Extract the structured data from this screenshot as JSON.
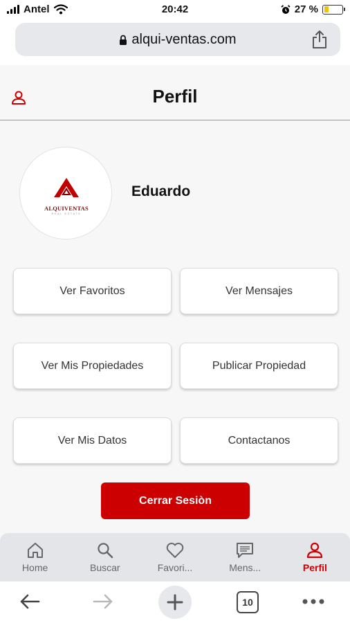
{
  "status_bar": {
    "carrier": "Antel",
    "time": "20:42",
    "battery": "27 %",
    "battery_level": 0.27
  },
  "browser": {
    "url": "alqui-ventas.com",
    "tab_count": "10"
  },
  "header": {
    "title": "Perfil"
  },
  "profile": {
    "name": "Eduardo",
    "logo_text": "ALQUIVENTAS",
    "logo_subtext": "REAL ESTATE"
  },
  "actions": {
    "favorites": "Ver Favoritos",
    "messages": "Ver Mensajes",
    "my_properties": "Ver Mis Propiedades",
    "publish": "Publicar Propiedad",
    "my_data": "Ver Mis Datos",
    "contact": "Contactanos",
    "logout": "Cerrar Sesiòn"
  },
  "tab_bar": {
    "items": [
      {
        "label": "Home",
        "icon": "home-icon"
      },
      {
        "label": "Buscar",
        "icon": "search-icon"
      },
      {
        "label": "Favori...",
        "icon": "heart-icon"
      },
      {
        "label": "Mens...",
        "icon": "message-icon"
      },
      {
        "label": "Perfil",
        "icon": "user-icon",
        "active": true
      }
    ]
  },
  "colors": {
    "accent": "#cc0000",
    "tab_inactive": "#666666",
    "battery": "#f2c200"
  }
}
